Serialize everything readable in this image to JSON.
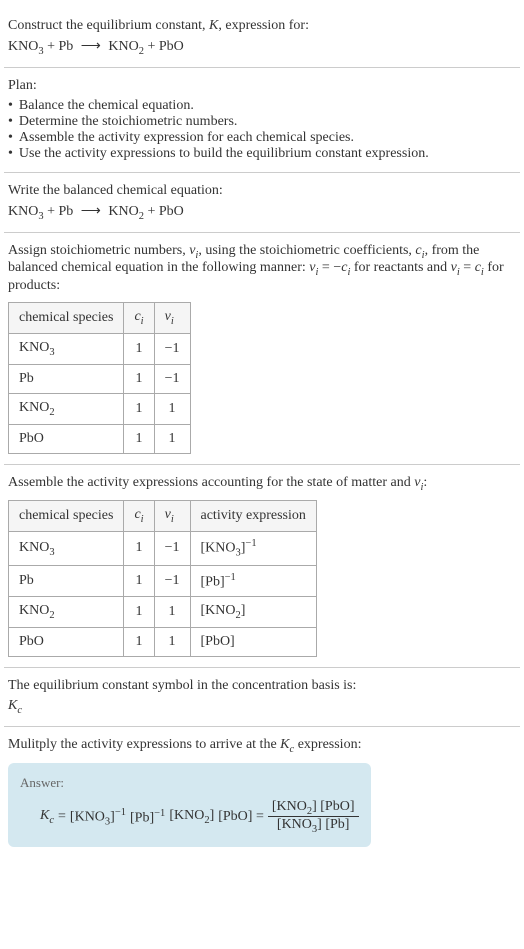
{
  "header": {
    "title_prefix": "Construct the equilibrium constant, ",
    "title_var": "K",
    "title_suffix": ", expression for:",
    "equation_lhs1": "KNO",
    "equation_lhs1_sub": "3",
    "equation_plus": " + Pb ",
    "equation_arrow": "⟶",
    "equation_rhs1": " KNO",
    "equation_rhs1_sub": "2",
    "equation_rhs2": " + PbO"
  },
  "plan": {
    "title": "Plan:",
    "items": [
      "Balance the chemical equation.",
      "Determine the stoichiometric numbers.",
      "Assemble the activity expression for each chemical species.",
      "Use the activity expressions to build the equilibrium constant expression."
    ]
  },
  "balanced": {
    "title": "Write the balanced chemical equation:"
  },
  "stoich": {
    "text_prefix": "Assign stoichiometric numbers, ",
    "nu_i": "ν",
    "i_sub": "i",
    "text_mid1": ", using the stoichiometric coefficients, ",
    "c_i": "c",
    "text_mid2": ", from the balanced chemical equation in the following manner: ",
    "rel1": " = −",
    "text_mid3": " for reactants and ",
    "rel2": " = ",
    "text_end": " for products:",
    "table": {
      "headers": [
        "chemical species",
        "c_i",
        "nu_i"
      ],
      "rows": [
        {
          "species": "KNO",
          "species_sub": "3",
          "c": "1",
          "nu": "−1"
        },
        {
          "species": "Pb",
          "species_sub": "",
          "c": "1",
          "nu": "−1"
        },
        {
          "species": "KNO",
          "species_sub": "2",
          "c": "1",
          "nu": "1"
        },
        {
          "species": "PbO",
          "species_sub": "",
          "c": "1",
          "nu": "1"
        }
      ]
    }
  },
  "activity": {
    "text": "Assemble the activity expressions accounting for the state of matter and ",
    "text_end": ":",
    "table": {
      "headers": [
        "chemical species",
        "c_i",
        "nu_i",
        "activity expression"
      ],
      "rows": [
        {
          "species": "KNO",
          "species_sub": "3",
          "c": "1",
          "nu": "−1",
          "act_pre": "[KNO",
          "act_sub": "3",
          "act_post": "]",
          "act_sup": "−1"
        },
        {
          "species": "Pb",
          "species_sub": "",
          "c": "1",
          "nu": "−1",
          "act_pre": "[Pb]",
          "act_sub": "",
          "act_post": "",
          "act_sup": "−1"
        },
        {
          "species": "KNO",
          "species_sub": "2",
          "c": "1",
          "nu": "1",
          "act_pre": "[KNO",
          "act_sub": "2",
          "act_post": "]",
          "act_sup": ""
        },
        {
          "species": "PbO",
          "species_sub": "",
          "c": "1",
          "nu": "1",
          "act_pre": "[PbO]",
          "act_sub": "",
          "act_post": "",
          "act_sup": ""
        }
      ]
    }
  },
  "symbol": {
    "text": "The equilibrium constant symbol in the concentration basis is:",
    "kc": "K",
    "kc_sub": "c"
  },
  "multiply": {
    "text_prefix": "Mulitply the activity expressions to arrive at the ",
    "text_suffix": " expression:"
  },
  "answer": {
    "label": "Answer:",
    "eq": " = ",
    "term1_pre": "[KNO",
    "term1_sub": "3",
    "term1_post": "]",
    "term1_sup": "−1",
    "term2_pre": " [Pb]",
    "term2_sup": "−1",
    "term3_pre": " [KNO",
    "term3_sub": "2",
    "term3_post": "]",
    "term4": " [PbO] = ",
    "num_pre": "[KNO",
    "num_sub": "2",
    "num_post": "] [PbO]",
    "den_pre": "[KNO",
    "den_sub": "3",
    "den_post": "] [Pb]"
  }
}
